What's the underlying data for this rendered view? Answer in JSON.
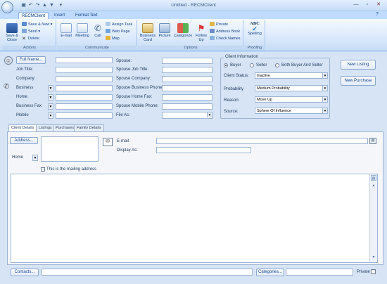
{
  "window": {
    "title": "Untitled - RECMClient"
  },
  "tabs": [
    "RECMClient",
    "Insert",
    "Format Text"
  ],
  "ribbon": {
    "actions": {
      "label": "Actions",
      "save_close": "Save & Close",
      "save_new": "Save & New",
      "send": "Send",
      "delete": "Delete"
    },
    "communicate": {
      "label": "Communicate",
      "email": "E-mail",
      "meeting": "Meeting",
      "call": "Call",
      "assign_task": "Assign Task",
      "web_page": "Web Page",
      "map": "Map"
    },
    "options": {
      "label": "Options",
      "business_card": "Business Card",
      "picture": "Picture",
      "categorize": "Categorize",
      "follow_up": "Follow Up",
      "private": "Private",
      "address_book": "Address Book",
      "check_names": "Check Names"
    },
    "proofing": {
      "label": "Proofing",
      "spelling": "Spelling",
      "abc": "ABC"
    }
  },
  "form": {
    "full_name_button": "Full Name...",
    "job_title": "Job Title:",
    "company": "Company:",
    "phones": [
      {
        "label": "Business"
      },
      {
        "label": "Home"
      },
      {
        "label": "Business Fax"
      },
      {
        "label": "Mobile"
      }
    ],
    "spouse": "Spouse:",
    "spouse_job_title": "Spouse Job Title:",
    "spouse_company": "Spouse Company:",
    "spouse_business_phone": "Spouse Business Phone:",
    "spouse_home_fax": "Spouse Home Fax:",
    "spouse_mobile_phone": "Spouse Mobile Phone:",
    "file_as": "File As:"
  },
  "client_info": {
    "title": "Client Information",
    "radios": [
      {
        "label": "Buyer",
        "selected": true
      },
      {
        "label": "Seller",
        "selected": false
      },
      {
        "label": "Both Buyer And Seller",
        "selected": false
      }
    ],
    "status_label": "Client Status:",
    "status_value": "Inactive",
    "probability_label": "Probability",
    "probability_value": "Medium Probability",
    "reason_label": "Reason:",
    "reason_value": "Move Up",
    "source_label": "Source:",
    "source_value": "Sphere Of Influence"
  },
  "side_buttons": {
    "new_listing": "New Listing",
    "new_purchase": "New Purchase"
  },
  "page_tabs": [
    "Client Details",
    "Listings",
    "Purchases",
    "Family Details"
  ],
  "details": {
    "address_button": "Address...",
    "address_type": "Home",
    "mailing_checkbox": "This is the mailing address",
    "email_label": "E-mail",
    "display_as_label": "Display As:"
  },
  "footer": {
    "contacts_button": "Contacts...",
    "categories_button": "Categories...",
    "private_label": "Private"
  }
}
